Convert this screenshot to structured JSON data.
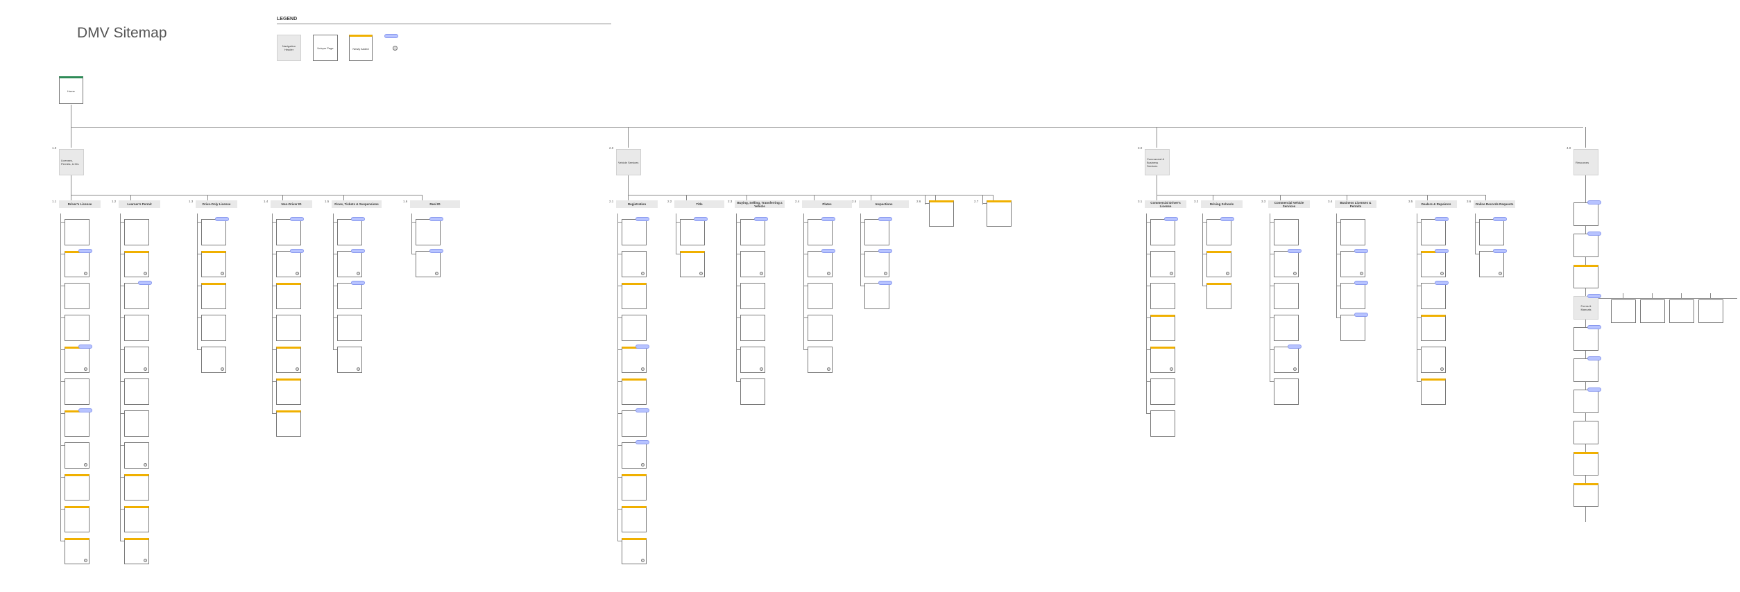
{
  "page": {
    "title": "DMV Sitemap",
    "legend": {
      "title": "LEGEND",
      "navigation_header": "Navigation Header",
      "unique_page": "Unique Page",
      "newly_added": "Newly Added",
      "badge_note": "",
      "level_note": ""
    }
  },
  "diagram": {
    "root": {
      "label": "Home"
    },
    "sections": [
      {
        "number": "1.0",
        "label": "Licenses, Permits, & IDs",
        "columns": [
          {
            "number": "1.1",
            "header": "Driver's License",
            "cards": 11
          },
          {
            "number": "1.2",
            "header": "Learner's Permit",
            "cards": 11
          },
          {
            "number": "1.3",
            "header": "Drive-Only License",
            "cards": 5
          },
          {
            "number": "1.4",
            "header": "Non-Driver ID",
            "cards": 7
          },
          {
            "number": "1.5",
            "header": "Fines, Tickets & Suspensions",
            "cards": 5
          },
          {
            "number": "1.6",
            "header": "Real ID",
            "cards": 2
          }
        ]
      },
      {
        "number": "2.0",
        "label": "Vehicle Services",
        "columns": [
          {
            "number": "2.1",
            "header": "Registration",
            "cards": 11
          },
          {
            "number": "2.2",
            "header": "Title",
            "cards": 2
          },
          {
            "number": "2.3",
            "header": "Buying, Selling, Transferring a Vehicle",
            "cards": 6
          },
          {
            "number": "2.4",
            "header": "Plates",
            "cards": 5
          },
          {
            "number": "2.5",
            "header": "Inspections",
            "cards": 3
          },
          {
            "number": "2.6",
            "header": "",
            "cards": 1
          },
          {
            "number": "2.7",
            "header": "",
            "cards": 1
          }
        ]
      },
      {
        "number": "3.0",
        "label": "Commercial & Business Services",
        "columns": [
          {
            "number": "3.1",
            "header": "Commercial Driver's License",
            "cards": 7
          },
          {
            "number": "3.2",
            "header": "Driving Schools",
            "cards": 3
          },
          {
            "number": "3.3",
            "header": "Commercial Vehicle Services",
            "cards": 6
          },
          {
            "number": "3.4",
            "header": "Business Licenses & Permits",
            "cards": 4
          },
          {
            "number": "3.5",
            "header": "Dealers & Repairers",
            "cards": 6
          },
          {
            "number": "3.6",
            "header": "Online Records Requests",
            "cards": 2
          }
        ]
      },
      {
        "number": "4.0",
        "label": "Resources",
        "columns": [
          {
            "number": "",
            "header": "",
            "cards": 10
          }
        ]
      }
    ],
    "forms": {
      "header": "Forms & Manuals",
      "items": [
        "",
        "",
        "",
        ""
      ]
    }
  }
}
